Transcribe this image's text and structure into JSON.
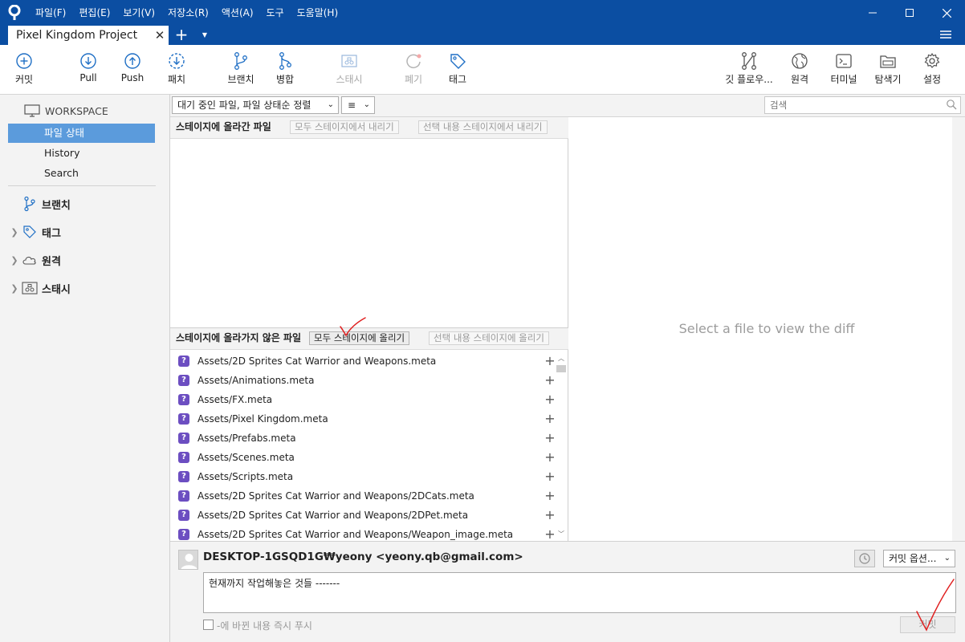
{
  "menu": [
    "파일(F)",
    "편집(E)",
    "보기(V)",
    "저장소(R)",
    "액션(A)",
    "도구",
    "도움말(H)"
  ],
  "tab": {
    "title": "Pixel Kingdom Project",
    "close": "✕",
    "add": "+",
    "dropdown": "▼"
  },
  "toolbar": {
    "commit": "커밋",
    "pull": "Pull",
    "push": "Push",
    "fetch": "패치",
    "branch": "브랜치",
    "merge": "병합",
    "stash": "스태시",
    "discard": "폐기",
    "tag": "태그",
    "gitflow": "깃 플로우...",
    "remote": "원격",
    "terminal": "터미널",
    "explorer": "탐색기",
    "settings": "설정"
  },
  "sidebar": {
    "workspace": "WORKSPACE",
    "items": [
      "파일 상태",
      "History",
      "Search"
    ],
    "groups": {
      "branches": "브랜치",
      "tags": "태그",
      "remotes": "원격",
      "stashes": "스태시"
    }
  },
  "filter": {
    "sort": "대기 중인 파일, 파일 상태순 정렬",
    "view": "≡",
    "search_placeholder": "검색"
  },
  "staged": {
    "title": "스테이지에 올라간 파일",
    "unstage_all": "모두 스테이지에서 내리기",
    "unstage_selected": "선택 내용 스테이지에서 내리기"
  },
  "unstaged": {
    "title": "스테이지에 올라가지 않은 파일",
    "stage_all": "모두 스테이지에 올리기",
    "stage_selected": "선택 내용 스테이지에 올리기",
    "status_badge": "?",
    "add_symbol": "+",
    "files": [
      "Assets/2D Sprites Cat Warrior and Weapons.meta",
      "Assets/Animations.meta",
      "Assets/FX.meta",
      "Assets/Pixel Kingdom.meta",
      "Assets/Prefabs.meta",
      "Assets/Scenes.meta",
      "Assets/Scripts.meta",
      "Assets/2D Sprites Cat Warrior and Weapons/2DCats.meta",
      "Assets/2D Sprites Cat Warrior and Weapons/2DPet.meta",
      "Assets/2D Sprites Cat Warrior and Weapons/Weapon_image.meta"
    ]
  },
  "diff": {
    "placeholder": "Select a file to view the diff"
  },
  "commit": {
    "author": "DESKTOP-1GSQD1G₩yeony <yeony.qb@gmail.com>",
    "options": "커밋 옵션...",
    "message": "현재까지 작업해놓은 것들 -------",
    "push_label": "-에 바뀐 내용 즉시 푸시",
    "button": "커밋"
  },
  "colors": {
    "titlebar": "#0b4ea2",
    "selection": "#5b9bdc",
    "badge": "#6c4ec1",
    "annotation": "#e02020"
  }
}
